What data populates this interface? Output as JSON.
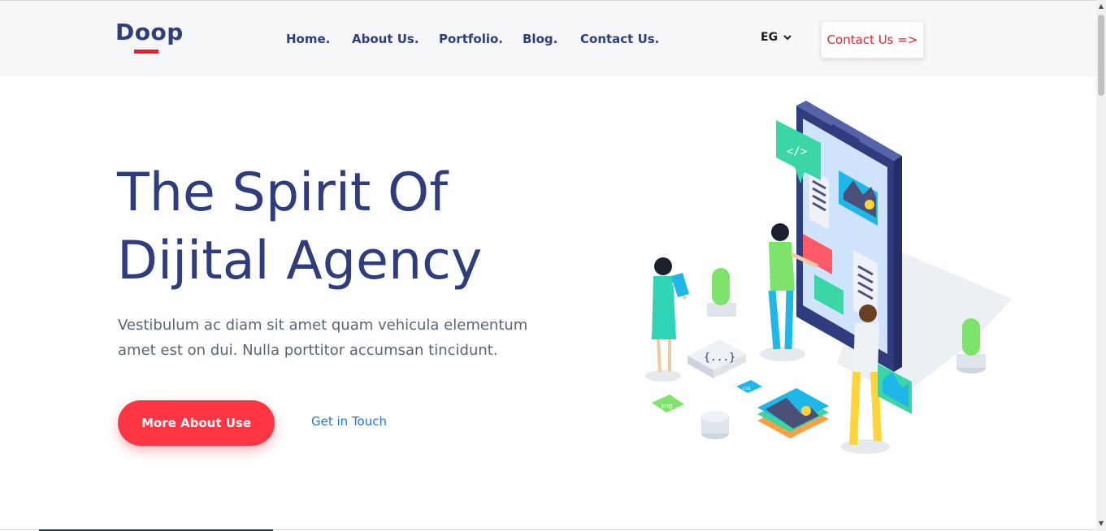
{
  "brand": {
    "name": "Doop",
    "accent": "#ee1c25",
    "primary": "#2f3d7e"
  },
  "nav": {
    "items": [
      {
        "label": "Home."
      },
      {
        "label": "About Us."
      },
      {
        "label": "Portfolio."
      },
      {
        "label": "Blog."
      },
      {
        "label": "Contact Us."
      }
    ],
    "language": "EG",
    "contact_button": "Contact Us =>"
  },
  "hero": {
    "title_line1": "The Spirit Of",
    "title_line2": "Dijital Agency",
    "description": "Vestibulum ac diam sit amet quam vehicula elementum amet est on dui. Nulla porttitor accumsan tincidunt.",
    "primary_button": "More About Use",
    "secondary_link": "Get in Touch"
  },
  "illustration": {
    "code_bubble": "</>",
    "brackets_block": "{...}",
    "tag_left": "png",
    "tag_right": "css"
  },
  "colors": {
    "button_red": "#fe3545",
    "link_blue": "#2776d4"
  }
}
